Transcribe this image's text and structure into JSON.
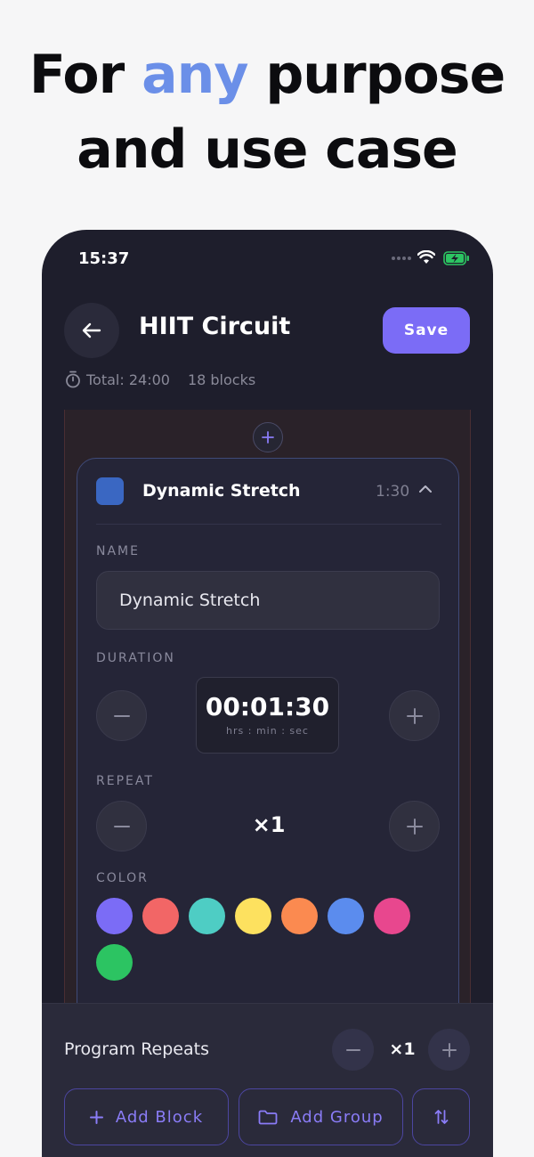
{
  "headline": {
    "prefix": "For ",
    "accent": "any",
    "line1_suffix": " purpose",
    "line2": "and use case"
  },
  "status": {
    "time": "15:37"
  },
  "header": {
    "title": "HIIT Circuit",
    "save_label": "Save",
    "total": "Total: 24:00",
    "blocks": "18 blocks"
  },
  "block": {
    "name": "Dynamic Stretch",
    "duration_short": "1:30",
    "name_label": "NAME",
    "name_value": "Dynamic Stretch",
    "duration_label": "DURATION",
    "duration_value": "00:01:30",
    "duration_unit": "hrs : min : sec",
    "repeat_label": "REPEAT",
    "repeat_value": "×1",
    "color_label": "COLOR",
    "swatch_color": "#3a67c2",
    "colors": [
      "#7b6cf6",
      "#f26666",
      "#4ecdc4",
      "#fde15f",
      "#fb8a50",
      "#5b8cee",
      "#e8478e",
      "#2cc462"
    ]
  },
  "footer": {
    "program_repeats_label": "Program Repeats",
    "program_repeats_value": "×1",
    "add_block_label": "Add Block",
    "add_group_label": "Add Group"
  },
  "theme": {
    "accent": "#7b6cf6",
    "headline_accent": "#6b8fe8",
    "background": "#1e1e2c"
  }
}
